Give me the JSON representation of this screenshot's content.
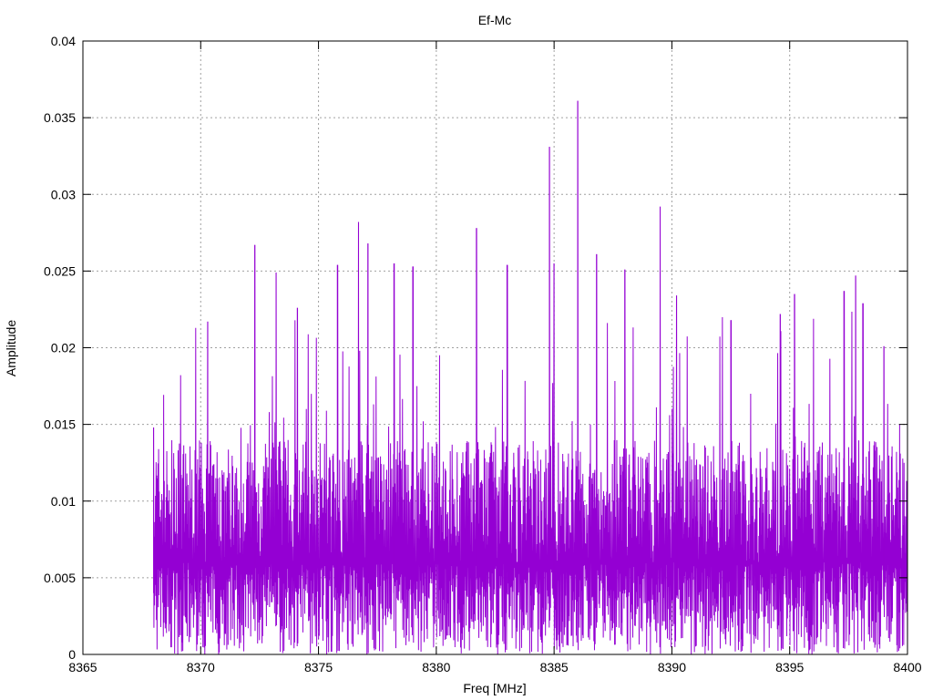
{
  "chart_data": {
    "type": "line",
    "title": "Ef-Mc",
    "xlabel": "Freq [MHz]",
    "ylabel": "Amplitude",
    "xlim": [
      8365,
      8400
    ],
    "ylim": [
      0,
      0.04
    ],
    "grid": true,
    "legend": "none",
    "series_color": "#9400D3",
    "x_ticks": [
      "8365",
      "8370",
      "8375",
      "8380",
      "8385",
      "8390",
      "8395",
      "8400"
    ],
    "y_ticks": [
      "0",
      "0.005",
      "0.01",
      "0.015",
      "0.02",
      "0.025",
      "0.03",
      "0.035",
      "0.04"
    ],
    "data_x_range": [
      8368,
      8400
    ],
    "noise_model": {
      "points": 2400,
      "low_max": 0.006,
      "high_min": 0.006,
      "high_spread": 0.008,
      "spike_prob": 0.08,
      "spike_extra": 0.01,
      "seed": 7
    },
    "peaks": [
      [
        8368.0,
        0.0148
      ],
      [
        8370.3,
        0.0217
      ],
      [
        8372.3,
        0.0267
      ],
      [
        8373.2,
        0.0249
      ],
      [
        8374.1,
        0.0226
      ],
      [
        8375.8,
        0.0254
      ],
      [
        8376.7,
        0.0282
      ],
      [
        8377.1,
        0.0268
      ],
      [
        8378.2,
        0.0255
      ],
      [
        8379.0,
        0.0253
      ],
      [
        8381.7,
        0.0278
      ],
      [
        8383.0,
        0.0254
      ],
      [
        8384.8,
        0.0331
      ],
      [
        8385.0,
        0.0255
      ],
      [
        8386.0,
        0.0361
      ],
      [
        8386.8,
        0.0261
      ],
      [
        8388.0,
        0.0251
      ],
      [
        8389.5,
        0.0292
      ],
      [
        8390.2,
        0.0234
      ],
      [
        8392.5,
        0.0218
      ],
      [
        8394.6,
        0.0222
      ],
      [
        8395.2,
        0.0235
      ],
      [
        8397.3,
        0.0237
      ],
      [
        8397.8,
        0.0247
      ],
      [
        8398.1,
        0.0229
      ],
      [
        8399.0,
        0.0201
      ]
    ]
  }
}
